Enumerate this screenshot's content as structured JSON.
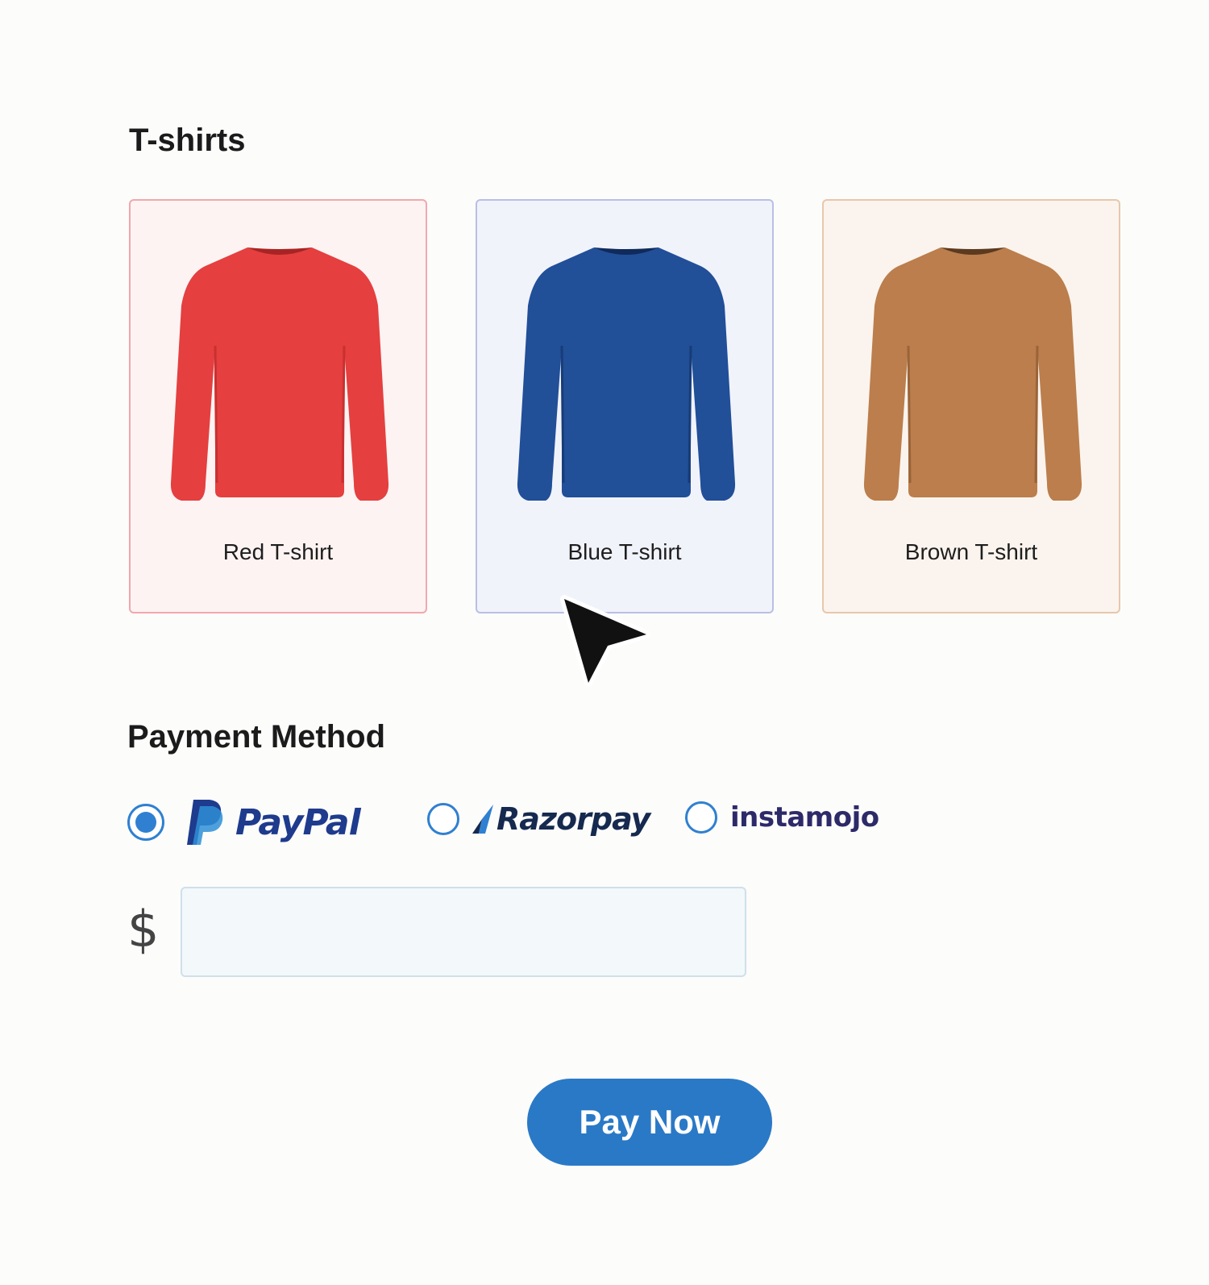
{
  "products_section": {
    "title": "T-shirts",
    "items": [
      {
        "label": "Red T-shirt",
        "color": "#e53e3e",
        "icon": "red-tshirt-image"
      },
      {
        "label": "Blue T-shirt",
        "color": "#1f4d96",
        "icon": "blue-tshirt-image"
      },
      {
        "label": "Brown T-shirt",
        "color": "#b97c4b",
        "icon": "brown-tshirt-image"
      }
    ]
  },
  "payment_section": {
    "title": "Payment Method",
    "options": [
      {
        "label": "PayPal",
        "selected": true,
        "icon": "paypal-logo"
      },
      {
        "label": "Razorpay",
        "selected": false,
        "icon": "razorpay-logo"
      },
      {
        "label": "instamojo",
        "selected": false,
        "icon": "instamojo-logo"
      }
    ],
    "amount": {
      "currency_symbol": "$",
      "value": "",
      "placeholder": ""
    },
    "submit_label": "Pay Now"
  },
  "colors": {
    "accent": "#2a79c6",
    "background": "#fcfcfb"
  }
}
